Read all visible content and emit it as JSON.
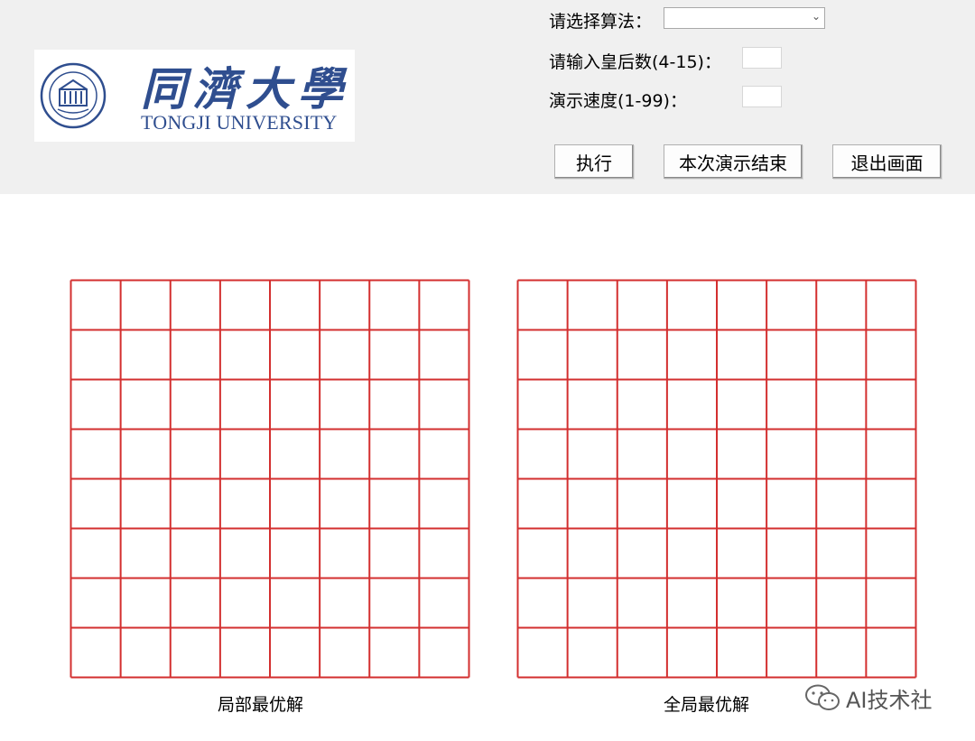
{
  "logo": {
    "name_cn": "同濟大學",
    "name_en": "TONGJI UNIVERSITY"
  },
  "controls": {
    "algorithm_label": "请选择算法：",
    "algorithm_value": "",
    "queens_label": "请输入皇后数(4-15)：",
    "queens_value": "",
    "speed_label": "演示速度(1-99)：",
    "speed_value": "",
    "execute_button": "执行",
    "end_demo_button": "本次演示结束",
    "exit_button": "退出画面"
  },
  "boards": {
    "size": 8,
    "line_color": "#d32f2f",
    "local_caption": "局部最优解",
    "global_caption": "全局最优解"
  },
  "watermark": {
    "text": "AI技术社"
  }
}
